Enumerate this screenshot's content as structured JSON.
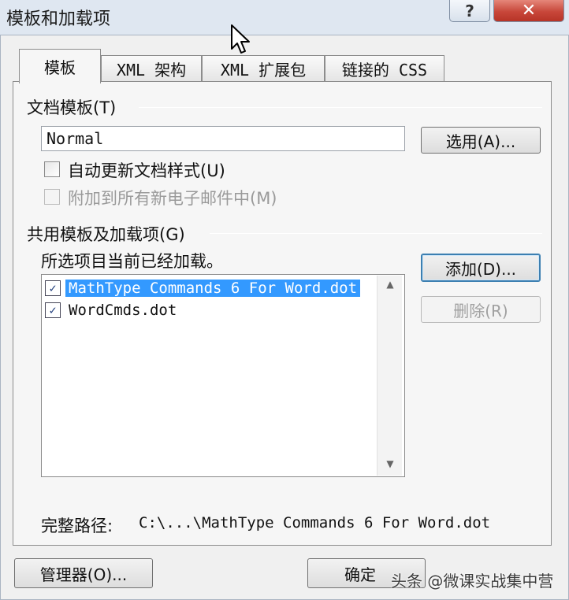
{
  "window": {
    "title": "模板和加载项",
    "help_label": "?",
    "close_label": "✕"
  },
  "tabs": [
    "模板",
    "XML 架构",
    "XML 扩展包",
    "链接的 CSS"
  ],
  "document_template": {
    "group_label": "文档模板(T)",
    "template_value": "Normal",
    "select_button": "选用(A)...",
    "auto_update_label": "自动更新文档样式(U)",
    "attach_email_label": "附加到所有新电子邮件中(M)"
  },
  "global_templates": {
    "group_label": "共用模板及加载项(G)",
    "subtitle": "所选项目当前已经加载。",
    "add_button": "添加(D)...",
    "remove_button": "删除(R)",
    "items": [
      {
        "label": "MathType Commands 6 For Word.dot",
        "checked": true,
        "selected": true
      },
      {
        "label": "WordCmds.dot",
        "checked": true,
        "selected": false
      }
    ]
  },
  "full_path": {
    "label": "完整路径:",
    "value": "C:\\...\\MathType Commands 6 For Word.dot"
  },
  "footer": {
    "organizer_button": "管理器(O)...",
    "ok_button": "确定",
    "watermark": "头条 @微课实战集中营"
  },
  "icons": {
    "check": "checkmark-icon",
    "scroll_up": "scroll-up-icon",
    "scroll_down": "scroll-down-icon",
    "cursor": "mouse-cursor-icon"
  }
}
